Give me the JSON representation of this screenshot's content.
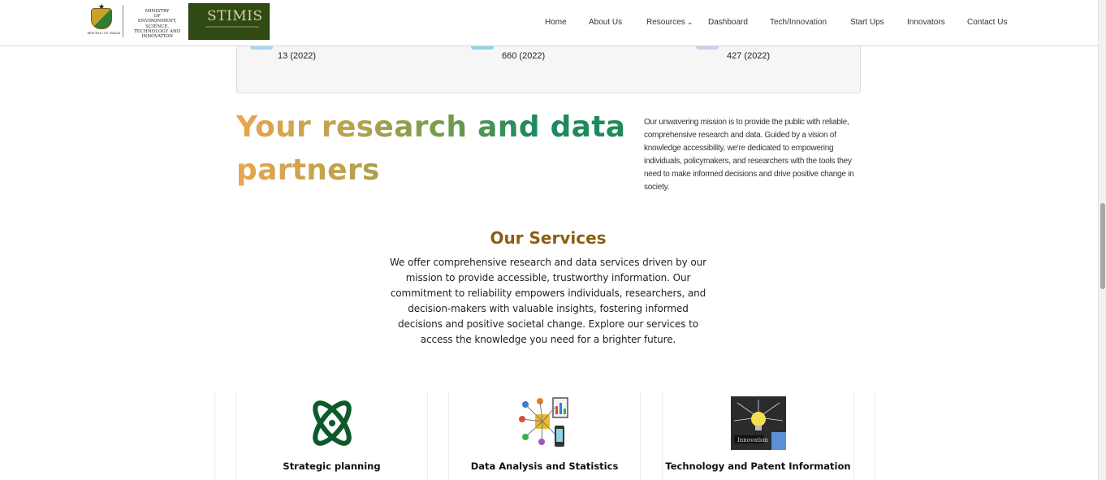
{
  "header": {
    "ministry_lines": [
      "MINISTRY",
      "OF",
      "ENVIRONMENT, SCIENCE,",
      "TECHNOLOGY AND",
      "INNOVATION"
    ],
    "coat_caption": "REPUBLIC OF GHANA",
    "stimis_title": "STIMIS",
    "nav": [
      {
        "label": "Home"
      },
      {
        "label": "About Us"
      },
      {
        "label": "Resources",
        "has_dropdown": true
      },
      {
        "label": "Dashboard"
      },
      {
        "label": "Tech/Innovation"
      },
      {
        "label": "Start Ups"
      },
      {
        "label": "Innovators"
      },
      {
        "label": "Contact Us"
      }
    ]
  },
  "stats": [
    {
      "value": "13 (2022)",
      "icon": "stat-icon",
      "color": "#a9d4f0"
    },
    {
      "value": "660 (2022)",
      "icon": "stat-icon",
      "color": "#8fd3e6"
    },
    {
      "value": "427 (2022)",
      "icon": "stat-icon",
      "color": "#d9c8ef"
    }
  ],
  "hero": {
    "title": "Your research and data partners",
    "description": "Our unwavering mission is to provide the public with reliable, comprehensive research and data. Guided by a vision of knowledge accessibility, we're dedicated to empowering individuals, policymakers, and researchers with the tools they need to make informed decisions and drive positive change in society."
  },
  "services": {
    "title": "Our Services",
    "description": "We offer comprehensive research and data services driven by our mission to provide accessible, trustworthy information. Our commitment to reliability empowers individuals, researchers, and decision-makers with valuable insights, fostering informed decisions and positive societal change. Explore our services to access the knowledge you need for a brighter future.",
    "cards": [
      {
        "label": "Strategic planning",
        "icon": "strategic-planning-icon"
      },
      {
        "label": "Data Analysis and Statistics",
        "icon": "data-analysis-icon"
      },
      {
        "label": "Technology and Patent Information",
        "icon": "innovation-icon"
      }
    ]
  },
  "colors": {
    "services_title": "#8b5e12",
    "hero_gradient_start": "#eba54d",
    "hero_gradient_end": "#1f8a5d",
    "stimis_bg": "#2f4a12"
  }
}
